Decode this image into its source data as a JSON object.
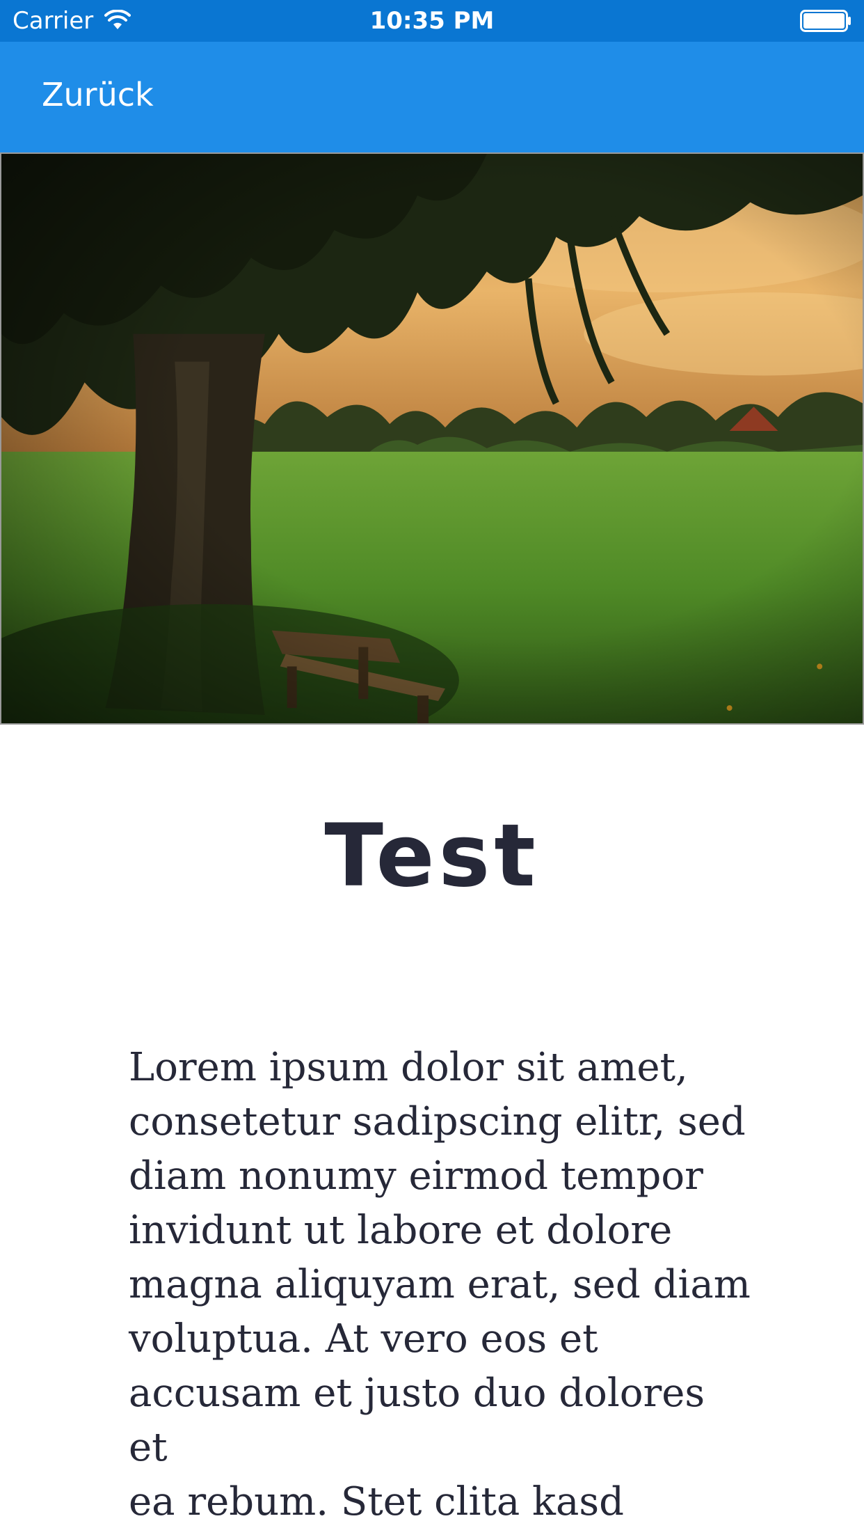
{
  "status_bar": {
    "carrier": "Carrier",
    "time": "10:35 PM",
    "icons": [
      "wifi-icon",
      "battery-icon"
    ]
  },
  "nav_bar": {
    "back_label": "Zurück"
  },
  "hero_image": {
    "icon": "landscape-photo",
    "colors": {
      "sky": "#e8b062",
      "grass": "#4f8a26",
      "trees": "#1f2c14"
    }
  },
  "content": {
    "title": "Test",
    "body": "Lorem ipsum dolor sit amet,\nconsetetur sadipscing elitr, sed\ndiam nonumy eirmod tempor\ninvidunt ut labore et dolore\nmagna aliquyam erat, sed diam\nvoluptua. At vero eos et\naccusam et justo duo dolores et\nea rebum. Stet clita kasd\ngubergren, no sea takimata"
  },
  "colors": {
    "status_bar": "#0a76d2",
    "nav_bar": "#1f8de8",
    "text": "#262838",
    "background": "#ffffff"
  }
}
